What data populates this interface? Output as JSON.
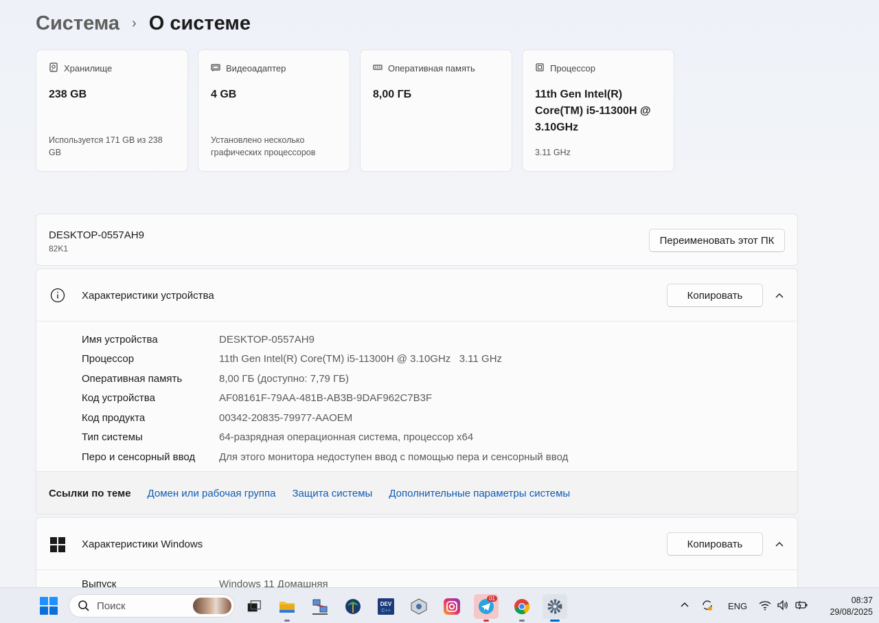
{
  "breadcrumb": {
    "parent": "Система",
    "separator": "›",
    "current": "О системе"
  },
  "cards": [
    {
      "icon": "storage-icon",
      "title": "Хранилище",
      "value": "238 GB",
      "sub": "Используется 171 GB из 238 GB"
    },
    {
      "icon": "gpu-icon",
      "title": "Видеоадаптер",
      "value": "4 GB",
      "sub": "Установлено несколько графических процессоров"
    },
    {
      "icon": "ram-icon",
      "title": "Оперативная память",
      "value": "8,00 ГБ",
      "sub": ""
    },
    {
      "icon": "cpu-icon",
      "title": "Процессор",
      "value": "11th Gen Intel(R) Core(TM) i5-11300H @ 3.10GHz",
      "sub": "3.11 GHz"
    }
  ],
  "pc": {
    "name": "DESKTOP-0557AH9",
    "model": "82K1",
    "rename_label": "Переименовать этот ПК"
  },
  "device": {
    "title": "Характеристики устройства",
    "copy_label": "Копировать",
    "specs": [
      {
        "label": "Имя устройства",
        "value": "DESKTOP-0557AH9"
      },
      {
        "label": "Процессор",
        "value": "11th Gen Intel(R) Core(TM) i5-11300H @ 3.10GHz   3.11 GHz"
      },
      {
        "label": "Оперативная память",
        "value": "8,00 ГБ (доступно: 7,79 ГБ)"
      },
      {
        "label": "Код устройства",
        "value": "AF08161F-79AA-481B-AB3B-9DAF962C7B3F"
      },
      {
        "label": "Код продукта",
        "value": "00342-20835-79977-AAOEM"
      },
      {
        "label": "Тип системы",
        "value": "64-разрядная операционная система, процессор x64"
      },
      {
        "label": "Перо и сенсорный ввод",
        "value": "Для этого монитора недоступен ввод с помощью пера и сенсорный ввод"
      }
    ]
  },
  "links": {
    "label": "Ссылки по теме",
    "items": [
      "Домен или рабочая группа",
      "Защита системы",
      "Дополнительные параметры системы"
    ]
  },
  "windows": {
    "title": "Характеристики Windows",
    "copy_label": "Копировать",
    "specs": [
      {
        "label": "Выпуск",
        "value": "Windows 11 Домашняя"
      }
    ]
  },
  "taskbar": {
    "search_placeholder": "Поиск",
    "telegram_badge": "01",
    "lang": "ENG",
    "time": "08:37",
    "date": "29/08/2025"
  },
  "colors": {
    "accent": "#0067c0",
    "link": "#0f5cb5",
    "alert": "#d13438"
  }
}
